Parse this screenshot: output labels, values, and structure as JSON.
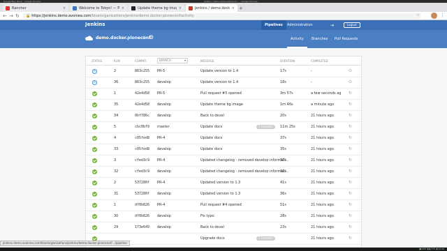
{
  "os_bar": {
    "left_text": "Google Play Music  ·  Simple Chrome",
    "center_text": "Jenkins / demo.docker.plonecon... - Google Chrome"
  },
  "browser": {
    "tabs": [
      {
        "label": "Rancher",
        "favicon_color": "#d9352c",
        "active": false
      },
      {
        "label": "Welcome to Tokyo! — Plo",
        "favicon_color": "#3b78c2",
        "active": false
      },
      {
        "label": "Update theme bg image",
        "favicon_color": "#222222",
        "active": false
      },
      {
        "label": "Jenkins / demo.docker.plo",
        "favicon_color": "#c33b2d",
        "active": true
      }
    ],
    "url_host": "https://jenkins.demo.avoinea.com",
    "url_path": "/blue/organizations/jenkins/demo.docker.ploneconf/activity"
  },
  "jenkins": {
    "logo": "Jenkins",
    "nav": {
      "pipelines": "Pipelines",
      "administration": "Administration",
      "logout": "Logout"
    },
    "pipeline_name": "demo.docker.ploneconf",
    "tabs": {
      "activity": "Activity",
      "branches": "Branches",
      "pull_requests": "Pull Requests"
    }
  },
  "table": {
    "headers": {
      "status": "STATUS",
      "run": "RUN",
      "commit": "COMMIT",
      "branch": "BRANCH",
      "message": "MESSAGE",
      "duration": "DURATION",
      "completed": "COMPLETED"
    },
    "rows": [
      {
        "status": "running",
        "run": "2",
        "commit": "863c255",
        "branch": "PR-5",
        "message": "Update version to 1.4",
        "duration": "17s",
        "completed": "-"
      },
      {
        "status": "running",
        "run": "36",
        "commit": "863c255",
        "branch": "develop",
        "message": "Update version to 1.4",
        "duration": "18s",
        "completed": "-"
      },
      {
        "status": "ok",
        "run": "1",
        "commit": "42e4d58",
        "branch": "PR-5",
        "message": "Pull request #5 opened",
        "duration": "3m 57s",
        "completed": "a few seconds ag"
      },
      {
        "status": "ok",
        "run": "35",
        "commit": "42e4d58",
        "branch": "develop",
        "message": "Update theme bg image",
        "duration": "1m 46s",
        "completed": "a minute ago"
      },
      {
        "status": "ok",
        "run": "34",
        "commit": "0bf786c",
        "branch": "develop",
        "message": "Back to devel",
        "duration": "20s",
        "completed": "21 hours ago"
      },
      {
        "status": "ok",
        "run": "5",
        "commit": "cbc0bf9",
        "branch": "master",
        "message": "Update docs",
        "badge": "1 commits",
        "duration": "11m 25s",
        "completed": "21 hours ago"
      },
      {
        "status": "ok",
        "run": "4",
        "commit": "c05fed8",
        "branch": "PR-4",
        "message": "Update docs",
        "duration": "37s",
        "completed": "21 hours ago"
      },
      {
        "status": "ok",
        "run": "33",
        "commit": "c05fed8",
        "branch": "develop",
        "message": "Update docs",
        "duration": "35s",
        "completed": "21 hours ago"
      },
      {
        "status": "ok",
        "run": "3",
        "commit": "cfed3c9",
        "branch": "PR-4",
        "message": "Updated changelog - removed develop informati...",
        "duration": "37s",
        "completed": "21 hours ago"
      },
      {
        "status": "ok",
        "run": "32",
        "commit": "cfed3c9",
        "branch": "develop",
        "message": "Updated changelog - removed develop informati...",
        "duration": "32s",
        "completed": "21 hours ago"
      },
      {
        "status": "ok",
        "run": "2",
        "commit": "537280f",
        "branch": "PR-4",
        "message": "Updated version to 1.3",
        "duration": "41s",
        "completed": "21 hours ago"
      },
      {
        "status": "ok",
        "run": "31",
        "commit": "537280f",
        "branch": "develop",
        "message": "Updated version to 1.3",
        "duration": "36s",
        "completed": "21 hours ago"
      },
      {
        "status": "ok",
        "run": "1",
        "commit": "df0b826",
        "branch": "PR-4",
        "message": "Pull request #4 opened",
        "duration": "51s",
        "completed": "21 hours ago"
      },
      {
        "status": "ok",
        "run": "30",
        "commit": "df0b826",
        "branch": "develop",
        "message": "Fix typo",
        "duration": "28s",
        "completed": "21 hours ago"
      },
      {
        "status": "ok",
        "run": "29",
        "commit": "173e649",
        "branch": "develop",
        "message": "Back to devel",
        "duration": "23s",
        "completed": "21 hours ago"
      },
      {
        "status": "ok",
        "run": "",
        "commit": "",
        "branch": "",
        "message": "Upgrade docs",
        "badge": "1 commits",
        "duration": "",
        "completed": "21 hours ago"
      }
    ]
  },
  "status_url": "jenkins.demo.avoinea.com/blue/organizations/jenkins/demo.docker.ploneconf/.../pipeline",
  "taskbar_text": "▮▮ 26% ▮ ▮ 27% ▮ 14:49"
}
